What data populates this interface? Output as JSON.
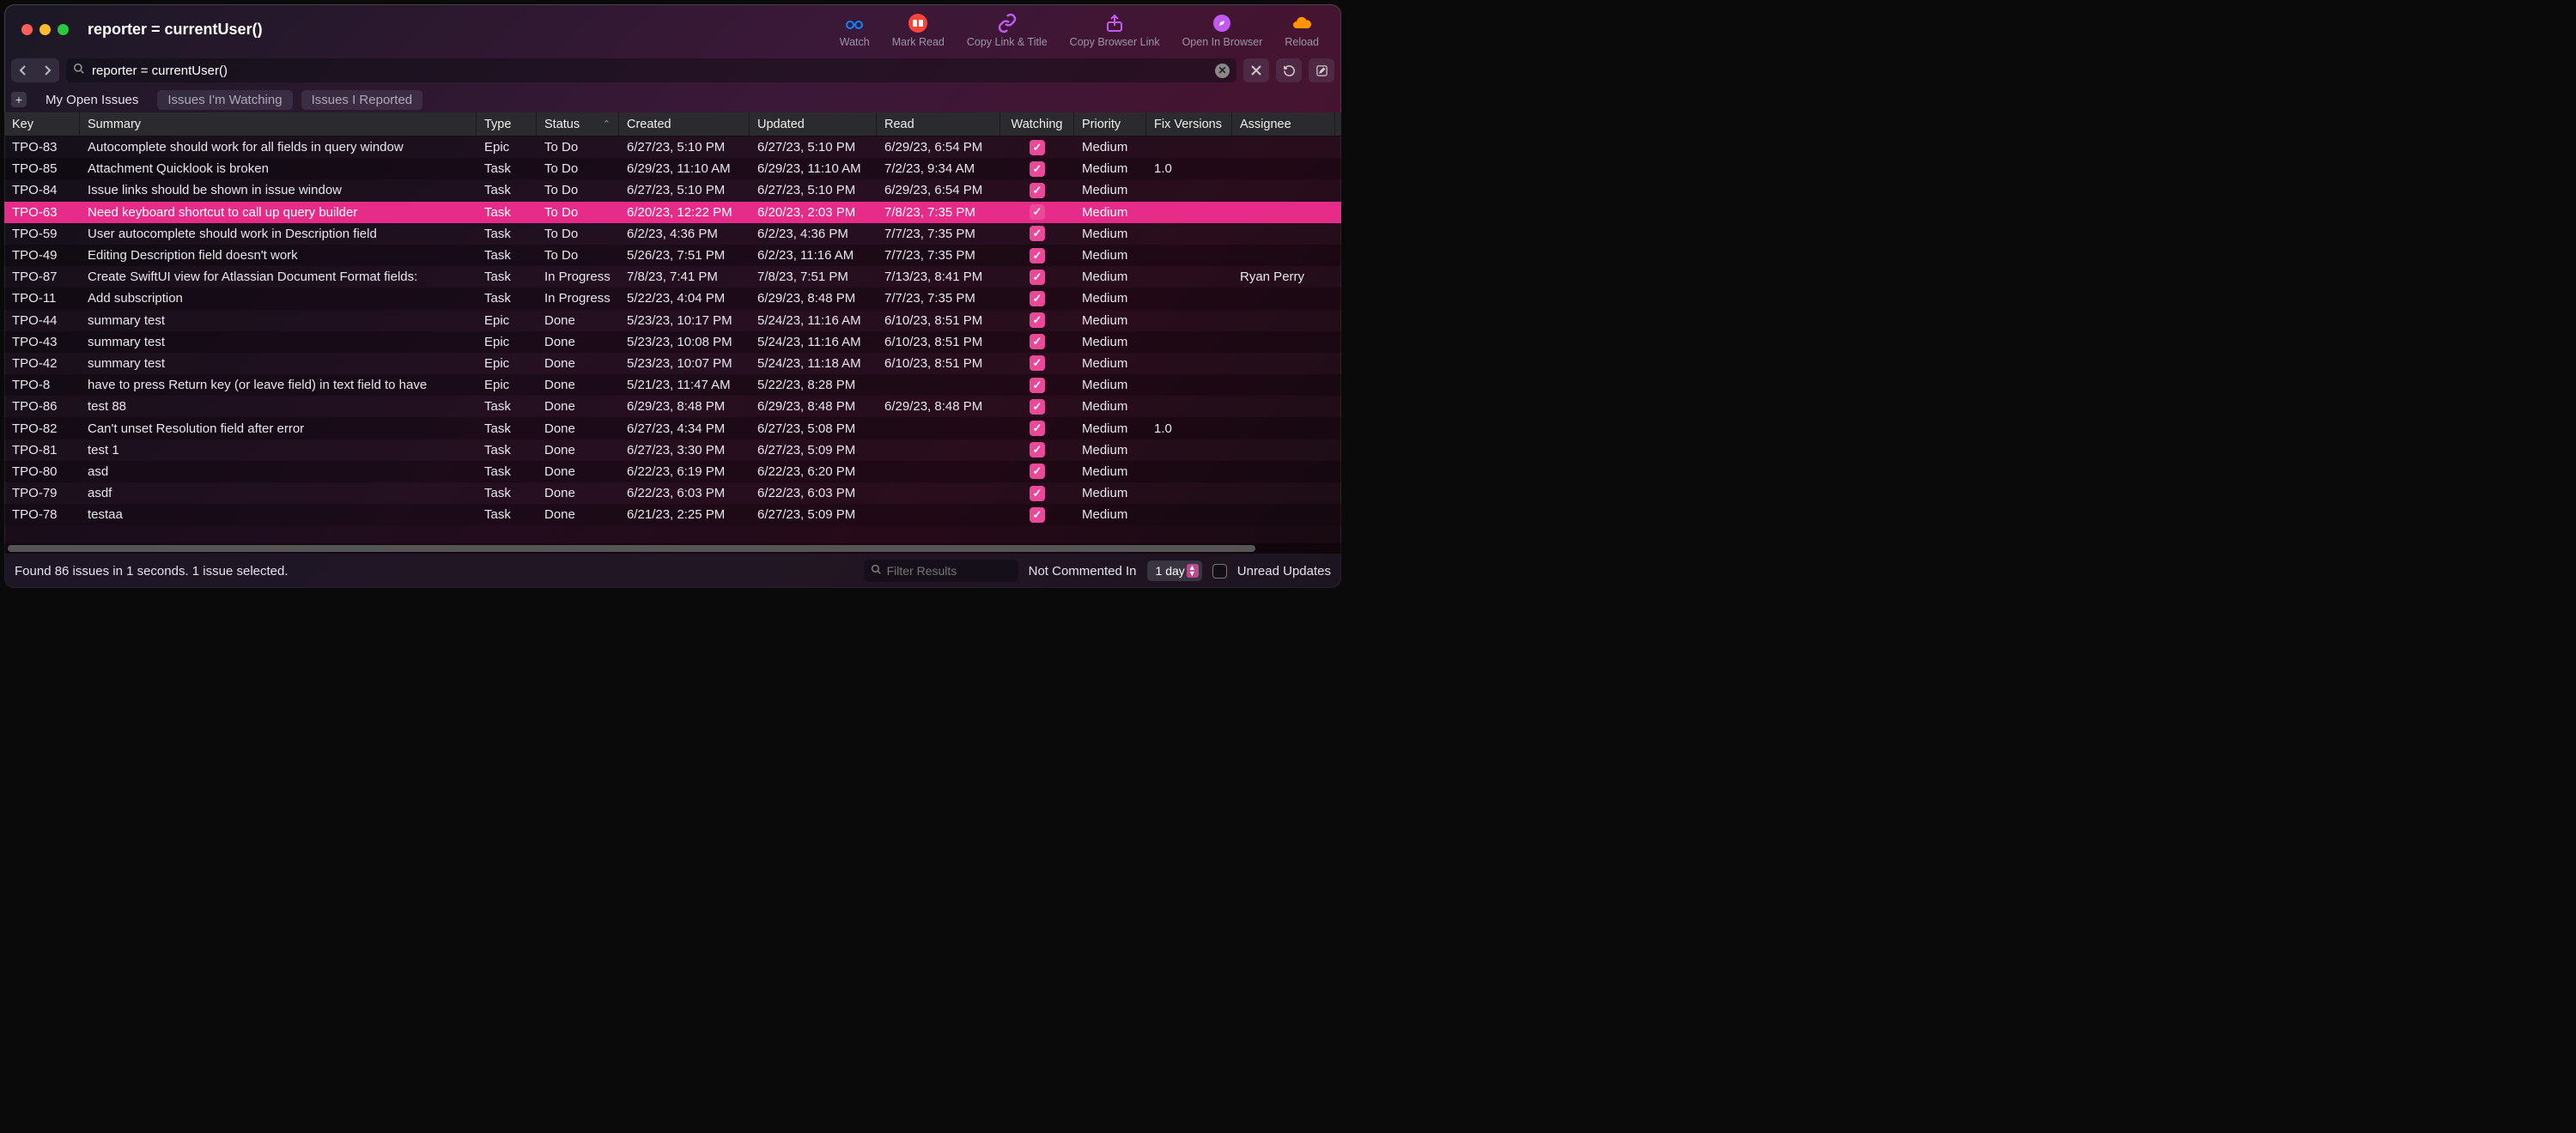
{
  "window": {
    "title": "reporter = currentUser()"
  },
  "toolbar": {
    "watch": "Watch",
    "mark_read": "Mark Read",
    "copy_link_title": "Copy Link & Title",
    "copy_browser_link": "Copy Browser Link",
    "open_in_browser": "Open In Browser",
    "reload": "Reload"
  },
  "search": {
    "value": "reporter = currentUser()"
  },
  "tabs": {
    "0": "My Open Issues",
    "1": "Issues I'm Watching",
    "2": "Issues I Reported"
  },
  "columns": {
    "key": "Key",
    "summary": "Summary",
    "type": "Type",
    "status": "Status",
    "created": "Created",
    "updated": "Updated",
    "read": "Read",
    "watching": "Watching",
    "priority": "Priority",
    "fix": "Fix Versions",
    "assignee": "Assignee"
  },
  "rows": [
    {
      "key": "TPO-83",
      "summary": "Autocomplete should work for all fields in query window",
      "type": "Epic",
      "status": "To Do",
      "created": "6/27/23, 5:10 PM",
      "updated": "6/27/23, 5:10 PM",
      "read": "6/29/23, 6:54 PM",
      "watching": true,
      "priority": "Medium",
      "fix": "",
      "assignee": ""
    },
    {
      "key": "TPO-85",
      "summary": "Attachment Quicklook is broken",
      "type": "Task",
      "status": "To Do",
      "created": "6/29/23, 11:10 AM",
      "updated": "6/29/23, 11:10 AM",
      "read": "7/2/23, 9:34 AM",
      "watching": true,
      "priority": "Medium",
      "fix": "1.0",
      "assignee": ""
    },
    {
      "key": "TPO-84",
      "summary": "Issue links should be shown in issue window",
      "type": "Task",
      "status": "To Do",
      "created": "6/27/23, 5:10 PM",
      "updated": "6/27/23, 5:10 PM",
      "read": "6/29/23, 6:54 PM",
      "watching": true,
      "priority": "Medium",
      "fix": "",
      "assignee": ""
    },
    {
      "key": "TPO-63",
      "summary": "Need keyboard shortcut to call up query builder",
      "type": "Task",
      "status": "To Do",
      "created": "6/20/23, 12:22 PM",
      "updated": "6/20/23, 2:03 PM",
      "read": "7/8/23, 7:35 PM",
      "watching": true,
      "priority": "Medium",
      "fix": "",
      "assignee": "",
      "selected": true
    },
    {
      "key": "TPO-59",
      "summary": "User autocomplete should work in Description field",
      "type": "Task",
      "status": "To Do",
      "created": "6/2/23, 4:36 PM",
      "updated": "6/2/23, 4:36 PM",
      "read": "7/7/23, 7:35 PM",
      "watching": true,
      "priority": "Medium",
      "fix": "",
      "assignee": ""
    },
    {
      "key": "TPO-49",
      "summary": "Editing Description field doesn't work",
      "type": "Task",
      "status": "To Do",
      "created": "5/26/23, 7:51 PM",
      "updated": "6/2/23, 11:16 AM",
      "read": "7/7/23, 7:35 PM",
      "watching": true,
      "priority": "Medium",
      "fix": "",
      "assignee": ""
    },
    {
      "key": "TPO-87",
      "summary": "Create SwiftUI view for Atlassian Document Format fields:",
      "type": "Task",
      "status": "In Progress",
      "created": "7/8/23, 7:41 PM",
      "updated": "7/8/23, 7:51 PM",
      "read": "7/13/23, 8:41 PM",
      "watching": true,
      "priority": "Medium",
      "fix": "",
      "assignee": "Ryan Perry"
    },
    {
      "key": "TPO-11",
      "summary": "Add subscription",
      "type": "Task",
      "status": "In Progress",
      "created": "5/22/23, 4:04 PM",
      "updated": "6/29/23, 8:48 PM",
      "read": "7/7/23, 7:35 PM",
      "watching": true,
      "priority": "Medium",
      "fix": "",
      "assignee": ""
    },
    {
      "key": "TPO-44",
      "summary": "summary test",
      "type": "Epic",
      "status": "Done",
      "created": "5/23/23, 10:17 PM",
      "updated": "5/24/23, 11:16 AM",
      "read": "6/10/23, 8:51 PM",
      "watching": true,
      "priority": "Medium",
      "fix": "",
      "assignee": ""
    },
    {
      "key": "TPO-43",
      "summary": "summary test",
      "type": "Epic",
      "status": "Done",
      "created": "5/23/23, 10:08 PM",
      "updated": "5/24/23, 11:16 AM",
      "read": "6/10/23, 8:51 PM",
      "watching": true,
      "priority": "Medium",
      "fix": "",
      "assignee": ""
    },
    {
      "key": "TPO-42",
      "summary": "summary test",
      "type": "Epic",
      "status": "Done",
      "created": "5/23/23, 10:07 PM",
      "updated": "5/24/23, 11:18 AM",
      "read": "6/10/23, 8:51 PM",
      "watching": true,
      "priority": "Medium",
      "fix": "",
      "assignee": ""
    },
    {
      "key": "TPO-8",
      "summary": "have to press Return key (or leave field) in text field to have",
      "type": "Epic",
      "status": "Done",
      "created": "5/21/23, 11:47 AM",
      "updated": "5/22/23, 8:28 PM",
      "read": "",
      "watching": true,
      "priority": "Medium",
      "fix": "",
      "assignee": ""
    },
    {
      "key": "TPO-86",
      "summary": "test 88",
      "type": "Task",
      "status": "Done",
      "created": "6/29/23, 8:48 PM",
      "updated": "6/29/23, 8:48 PM",
      "read": "6/29/23, 8:48 PM",
      "watching": true,
      "priority": "Medium",
      "fix": "",
      "assignee": ""
    },
    {
      "key": "TPO-82",
      "summary": "Can't unset Resolution field after error",
      "type": "Task",
      "status": "Done",
      "created": "6/27/23, 4:34 PM",
      "updated": "6/27/23, 5:08 PM",
      "read": "",
      "watching": true,
      "priority": "Medium",
      "fix": "1.0",
      "assignee": ""
    },
    {
      "key": "TPO-81",
      "summary": "test 1",
      "type": "Task",
      "status": "Done",
      "created": "6/27/23, 3:30 PM",
      "updated": "6/27/23, 5:09 PM",
      "read": "",
      "watching": true,
      "priority": "Medium",
      "fix": "",
      "assignee": ""
    },
    {
      "key": "TPO-80",
      "summary": "asd",
      "type": "Task",
      "status": "Done",
      "created": "6/22/23, 6:19 PM",
      "updated": "6/22/23, 6:20 PM",
      "read": "",
      "watching": true,
      "priority": "Medium",
      "fix": "",
      "assignee": ""
    },
    {
      "key": "TPO-79",
      "summary": "asdf",
      "type": "Task",
      "status": "Done",
      "created": "6/22/23, 6:03 PM",
      "updated": "6/22/23, 6:03 PM",
      "read": "",
      "watching": true,
      "priority": "Medium",
      "fix": "",
      "assignee": ""
    },
    {
      "key": "TPO-78",
      "summary": "testaa",
      "type": "Task",
      "status": "Done",
      "created": "6/21/23, 2:25 PM",
      "updated": "6/27/23, 5:09 PM",
      "read": "",
      "watching": true,
      "priority": "Medium",
      "fix": "",
      "assignee": ""
    }
  ],
  "footer": {
    "status": "Found 86 issues in 1 seconds. 1 issue selected.",
    "filter_placeholder": "Filter Results",
    "not_commented": "Not Commented In",
    "duration": "1 day",
    "unread": "Unread Updates"
  }
}
